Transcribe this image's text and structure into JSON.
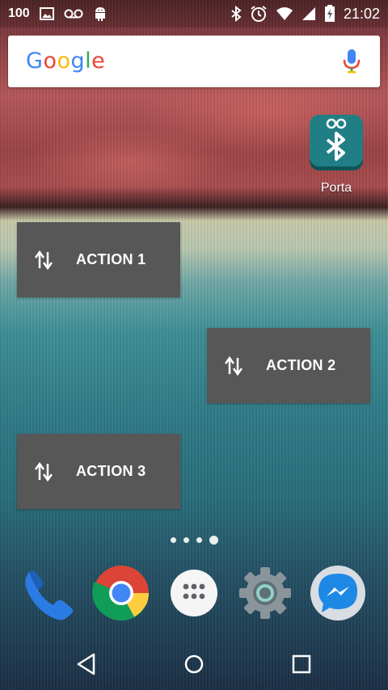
{
  "status_bar": {
    "battery_level_text": "100",
    "time": "21:02",
    "icons": [
      "image-icon",
      "voicemail-icon",
      "android-icon",
      "bluetooth-icon",
      "alarm-icon",
      "wifi-icon",
      "signal-icon",
      "battery-charging-icon"
    ]
  },
  "search": {
    "logo_text": "Google",
    "logo_colors": [
      "#4285F4",
      "#EA4335",
      "#FBBC05",
      "#4285F4",
      "#34A853",
      "#EA4335"
    ],
    "mic_icon": "mic-icon"
  },
  "home_apps": [
    {
      "label": "Porta",
      "icon": "bluetooth-arduino-icon",
      "color": "#1f7f85"
    }
  ],
  "widgets": [
    {
      "label": "ACTION 1",
      "icon": "swap-vertical-icon"
    },
    {
      "label": "ACTION 2",
      "icon": "swap-vertical-icon"
    },
    {
      "label": "ACTION 3",
      "icon": "swap-vertical-icon"
    }
  ],
  "page_indicator": {
    "count": 4,
    "active_index": 3
  },
  "dock": [
    {
      "name": "phone",
      "icon": "phone-icon"
    },
    {
      "name": "chrome",
      "icon": "chrome-icon"
    },
    {
      "name": "app-drawer",
      "icon": "app-drawer-icon"
    },
    {
      "name": "settings",
      "icon": "settings-icon"
    },
    {
      "name": "messenger",
      "icon": "messenger-icon"
    }
  ],
  "nav_bar": {
    "buttons": [
      "back-icon",
      "home-icon",
      "recents-icon"
    ]
  }
}
